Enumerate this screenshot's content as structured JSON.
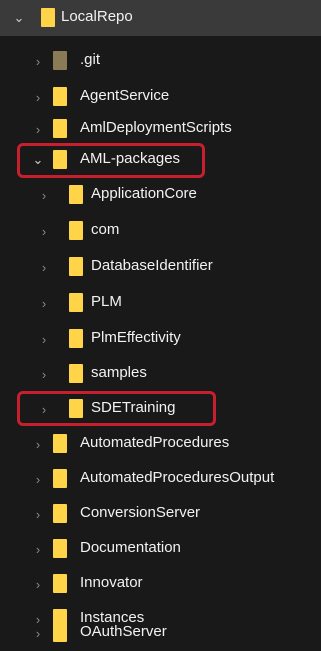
{
  "tree": {
    "root": {
      "label": "LocalRepo",
      "icon": "folder-icon",
      "expanded": true
    },
    "items": [
      {
        "label": ".git",
        "icon": "folder-icon",
        "hidden_style": true
      },
      {
        "label": "AgentService",
        "icon": "folder-icon"
      },
      {
        "label": "AmlDeploymentScripts",
        "icon": "folder-icon"
      },
      {
        "label": "AML-packages",
        "icon": "folder-icon",
        "expanded": true,
        "highlighted": true
      },
      {
        "label": "ApplicationCore",
        "icon": "folder-icon"
      },
      {
        "label": "com",
        "icon": "folder-icon"
      },
      {
        "label": "DatabaseIdentifier",
        "icon": "folder-icon"
      },
      {
        "label": "PLM",
        "icon": "folder-icon"
      },
      {
        "label": "PlmEffectivity",
        "icon": "folder-icon"
      },
      {
        "label": "samples",
        "icon": "folder-icon"
      },
      {
        "label": "SDETraining",
        "icon": "folder-icon",
        "highlighted": true
      },
      {
        "label": "AutomatedProcedures",
        "icon": "folder-icon"
      },
      {
        "label": "AutomatedProceduresOutput",
        "icon": "folder-icon"
      },
      {
        "label": "ConversionServer",
        "icon": "folder-icon"
      },
      {
        "label": "Documentation",
        "icon": "folder-icon"
      },
      {
        "label": "Innovator",
        "icon": "folder-icon"
      },
      {
        "label": "Instances",
        "icon": "folder-icon"
      },
      {
        "label": "OAuthServer",
        "icon": "folder-icon"
      }
    ]
  },
  "colors": {
    "background": "#191919",
    "root_row": "#3a3a3a",
    "folder": "#ffd449",
    "highlight": "#c71f2d",
    "text": "#f2f2f2"
  }
}
